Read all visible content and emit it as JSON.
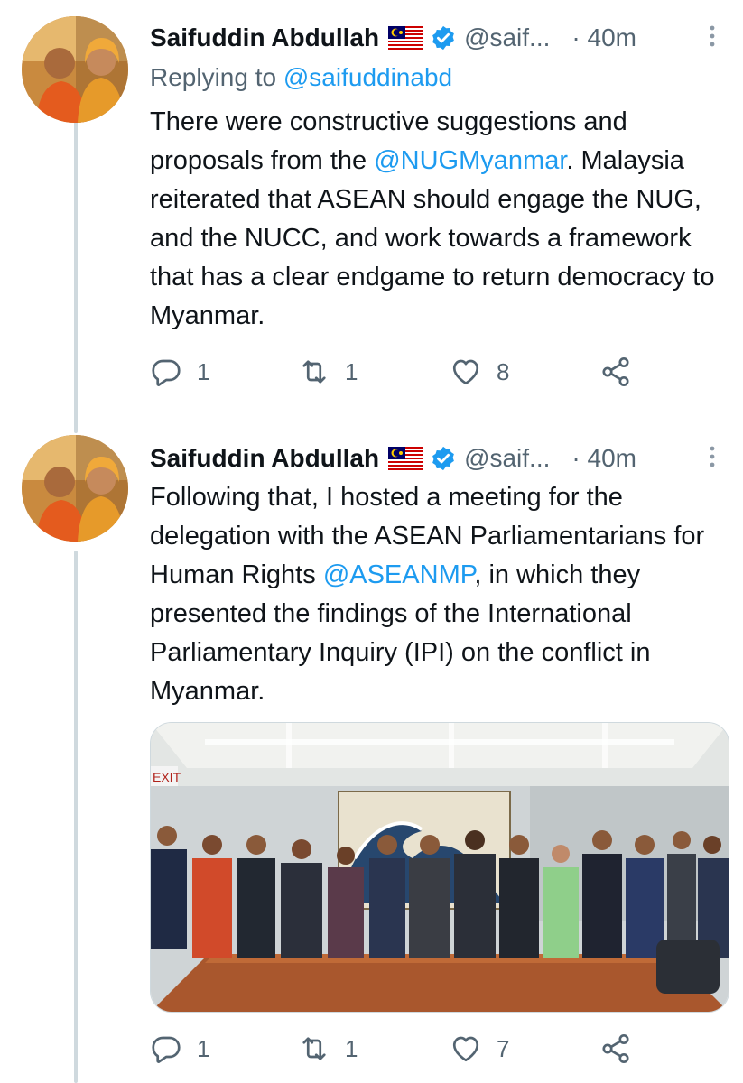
{
  "tweets": [
    {
      "author": "Saifuddin Abdullah",
      "handle": "@saif...",
      "time": "· 40m",
      "replying_label": "Replying to ",
      "replying_handle": "@saifuddinabd",
      "text": {
        "p1": "There were constructive suggestions and proposals from the ",
        "link1": "@NUGMyanmar",
        "p2": ". Malaysia reiterated that ASEAN should engage the NUG, and the NUCC, and work towards a framework that has a clear endgame to return democracy to Myanmar."
      },
      "counts": {
        "replies": "1",
        "retweets": "1",
        "likes": "8"
      }
    },
    {
      "author": "Saifuddin Abdullah",
      "handle": "@saif...",
      "time": "· 40m",
      "text": {
        "p1": "Following that, I hosted a meeting for the delegation with the ASEAN Parliamentarians for Human Rights ",
        "link1": "@ASEANMP",
        "p2": ", in which they presented the findings of the International Parliamentary Inquiry (IPI) on the conflict in Myanmar."
      },
      "photo_sign": "EXIT",
      "counts": {
        "replies": "1",
        "retweets": "1",
        "likes": "7"
      }
    }
  ],
  "icons": {
    "reply": "reply-icon",
    "retweet": "retweet-icon",
    "like": "like-icon",
    "share": "share-icon",
    "verified": "verified-badge-icon",
    "flag": "malaysia-flag-icon",
    "more": "more-vertical-icon"
  },
  "colors": {
    "link": "#1d9bf0",
    "secondary_text": "#536471",
    "thread_line": "#cfd9de"
  }
}
